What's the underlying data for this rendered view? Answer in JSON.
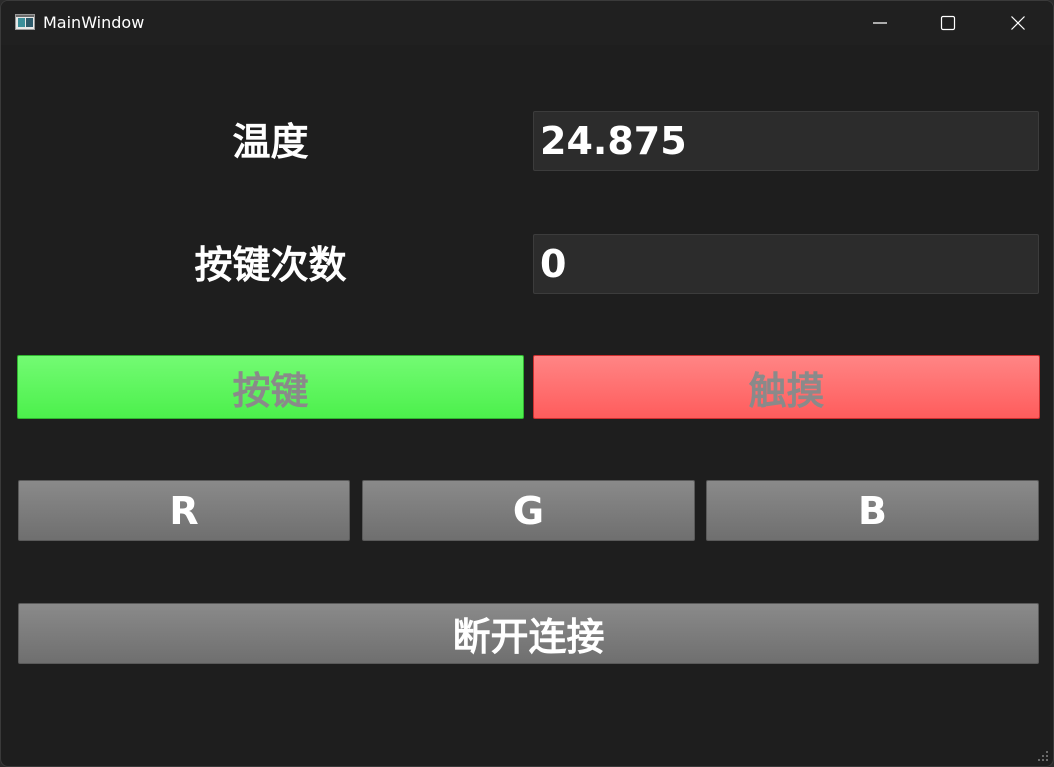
{
  "window": {
    "title": "MainWindow",
    "icons": {
      "app": "app-window-icon",
      "minimize": "minimize-icon",
      "maximize": "maximize-icon",
      "close": "close-icon",
      "grip": "resize-grip-icon"
    }
  },
  "temperature": {
    "label": "温度",
    "value": "24.875"
  },
  "key_count": {
    "label": "按键次数",
    "value": "0"
  },
  "indicators": {
    "key_label": "按键",
    "touch_label": "触摸",
    "key_color": "#4cf04c",
    "touch_color": "#ff5c5c"
  },
  "rgb": {
    "r_label": "R",
    "g_label": "G",
    "b_label": "B"
  },
  "disconnect": {
    "label": "断开连接"
  }
}
